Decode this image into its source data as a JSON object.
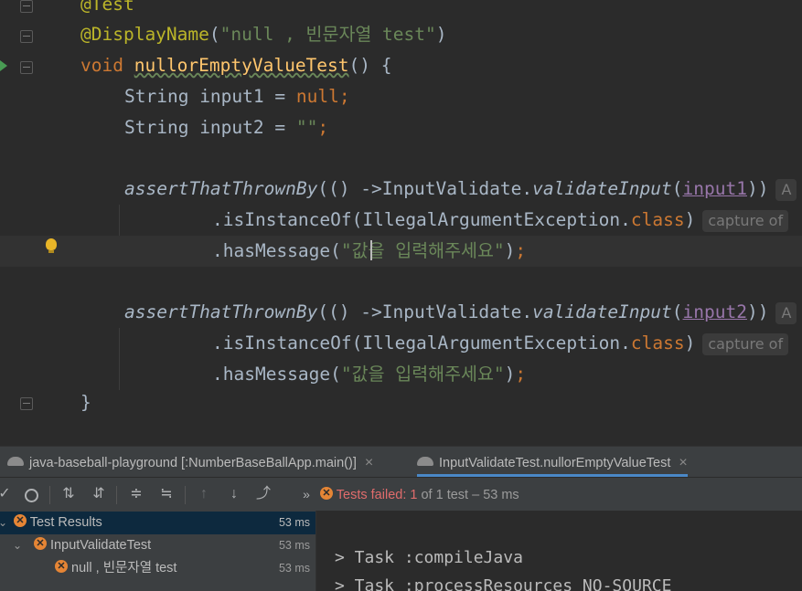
{
  "editor": {
    "line0": "@Test",
    "display_name_ann": "@DisplayName",
    "display_name_str": "\"null , 빈문자열 test\"",
    "void_kw": "void",
    "method_name": "nullorEmptyValueTest",
    "method_tail": "() {",
    "type_string": "String",
    "input1_decl": " input1 = ",
    "null_kw": "null",
    "semi": ";",
    "input2_decl": " input2 = ",
    "empty_str": "\"\"",
    "assert_fn": "assertThatThrownBy",
    "assert_open": "(() ->InputValidate.",
    "validate_fn": "validateInput",
    "paren_open": "(",
    "arg1": "input1",
    "arg2": "input2",
    "paren_close2": "))",
    "hint_a": "A",
    "isinstance": ".isInstanceOf(IllegalArgumentException.",
    "class_kw": "class",
    "close_paren": ")",
    "capture_hint": "capture of",
    "hasmessage_open": ".hasMessage(",
    "message_str": "\"값을 입력해주세요\"",
    "message_close": ")",
    "closing_brace": "}"
  },
  "tool_tabs": [
    {
      "label": "java-baseball-playground [:NumberBaseBallApp.main()]",
      "close": "×"
    },
    {
      "label": "InputValidateTest.nullorEmptyValueTest",
      "close": "×"
    }
  ],
  "toolbar": {
    "status_fail": "Tests failed: ",
    "status_count": "1",
    "status_rest": " of 1 test – 53 ms",
    "more": "»"
  },
  "tree": [
    {
      "label": "Test Results",
      "duration": "53 ms"
    },
    {
      "label": "InputValidateTest",
      "duration": "53 ms"
    },
    {
      "label": "null , 빈문자열 test",
      "duration": "53 ms"
    }
  ],
  "console": [
    "> Task :compileJava",
    "> Task :processResources NO-SOURCE"
  ],
  "colors": {
    "accent": "#4a88c7",
    "fail": "#e58535",
    "selection": "#0d293e"
  }
}
